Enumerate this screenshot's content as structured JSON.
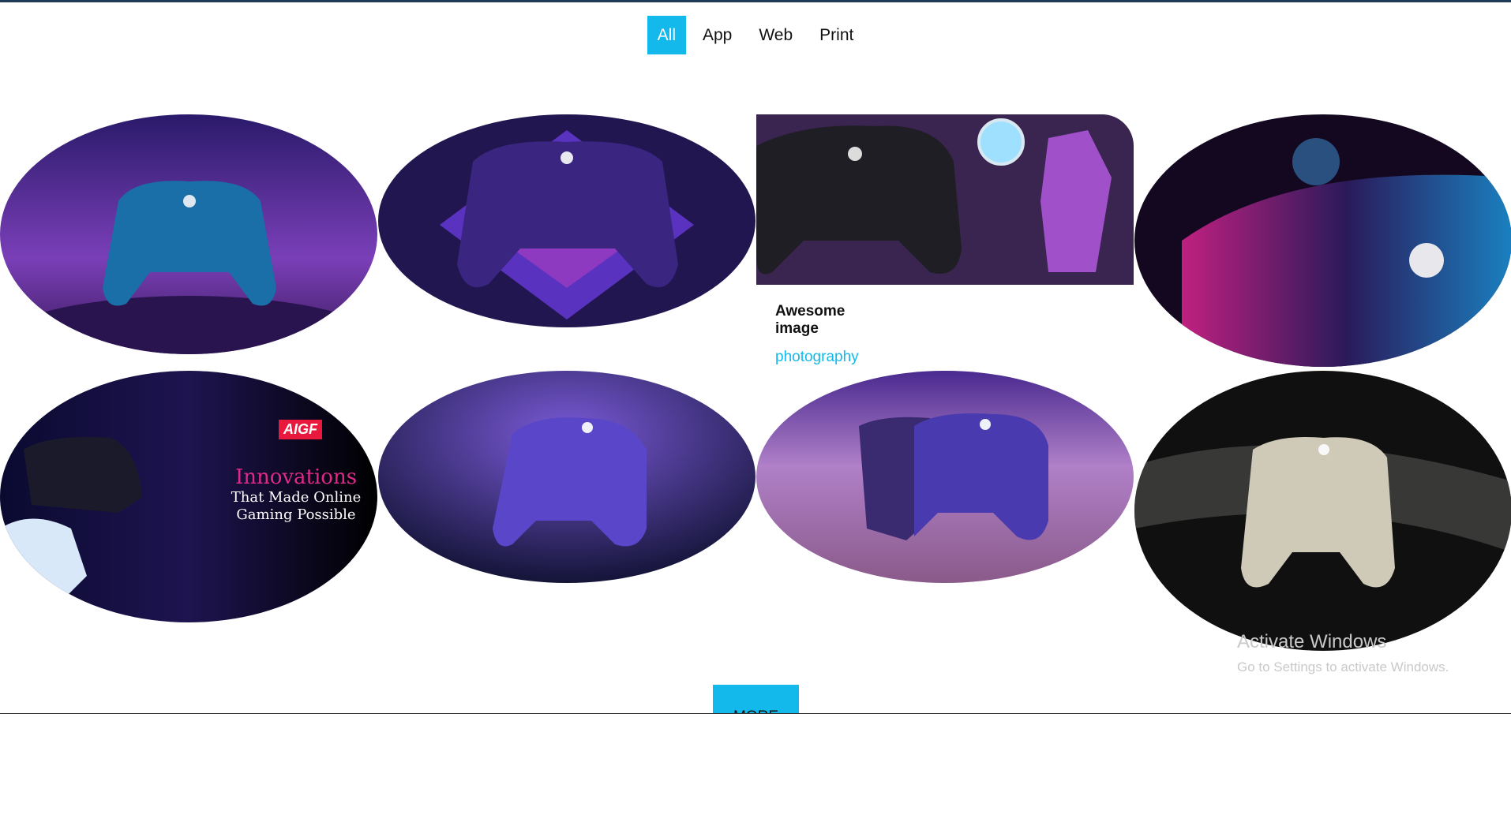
{
  "filters": [
    {
      "label": "All",
      "active": true
    },
    {
      "label": "App",
      "active": false
    },
    {
      "label": "Web",
      "active": false
    },
    {
      "label": "Print",
      "active": false
    }
  ],
  "gallery": {
    "caption": {
      "title": "Awesome image",
      "subtitle": "photography"
    },
    "items": [
      {
        "name": "blue-controller-desert-stars",
        "colors": [
          "#3a1a6a",
          "#7a3fb8",
          "#1b6fa8"
        ]
      },
      {
        "name": "purple-controller-diamond",
        "colors": [
          "#2a1a5a",
          "#6a3ad0",
          "#c040c0"
        ]
      },
      {
        "name": "black-controller-fortnite",
        "colors": [
          "#3a2450",
          "#1e1e24",
          "#a050c8"
        ]
      },
      {
        "name": "controller-closeup-neon",
        "colors": [
          "#1a0a2a",
          "#c02080",
          "#1a80c0"
        ]
      },
      {
        "name": "aigf-innovations-banner",
        "colors": [
          "#0a0a28",
          "#2a1a60",
          "#000000"
        ],
        "badge": "AIGF",
        "headline": "Innovations",
        "subline1": "That Made Online",
        "subline2": "Gaming Possible"
      },
      {
        "name": "purple-controller-nebula",
        "colors": [
          "#1a1a4a",
          "#4a3ab0",
          "#2a5ab0"
        ]
      },
      {
        "name": "purple-controllers-pink-desert",
        "colors": [
          "#3a1a6a",
          "#c080c0",
          "#5a3aa0"
        ]
      },
      {
        "name": "silver-controller-dark",
        "colors": [
          "#101010",
          "#3a3a3a",
          "#cfcab8"
        ]
      }
    ]
  },
  "more_button": {
    "label": "MORE"
  },
  "watermark": {
    "title": "Activate Windows",
    "subtitle": "Go to Settings to activate Windows."
  }
}
